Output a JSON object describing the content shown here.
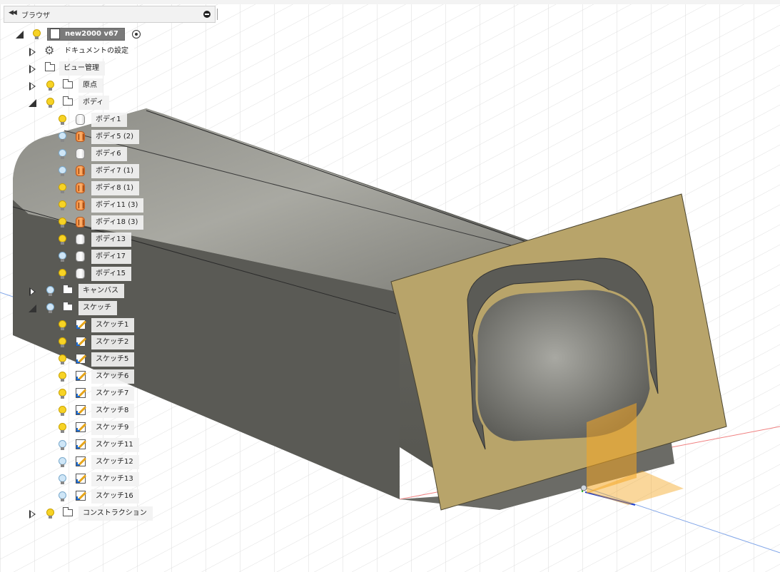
{
  "browser": {
    "title": "ブラウザ",
    "root": {
      "name": "new2000 v67"
    },
    "items": [
      {
        "label": "ドキュメントの設定",
        "icon": "gear-icon"
      },
      {
        "label": "ビュー管理",
        "icon": "folder-icon"
      },
      {
        "label": "原点",
        "icon": "folder-icon"
      },
      {
        "label": "ボディ",
        "icon": "folder-icon"
      }
    ],
    "bodies": [
      {
        "label": "ボディ1",
        "color": "gray"
      },
      {
        "label": "ボディ5 (2)",
        "color": "orange"
      },
      {
        "label": "ボディ6",
        "color": "gray"
      },
      {
        "label": "ボディ7 (1)",
        "color": "orange"
      },
      {
        "label": "ボディ8 (1)",
        "color": "orange"
      },
      {
        "label": "ボディ11 (3)",
        "color": "orange"
      },
      {
        "label": "ボディ18 (3)",
        "color": "orange"
      },
      {
        "label": "ボディ13",
        "color": "gray"
      },
      {
        "label": "ボディ17",
        "color": "gray"
      },
      {
        "label": "ボディ15",
        "color": "gray"
      }
    ],
    "canvas": {
      "label": "キャンバス"
    },
    "sketch_folder": {
      "label": "スケッチ"
    },
    "sketches": [
      {
        "label": "スケッチ1"
      },
      {
        "label": "スケッチ2"
      },
      {
        "label": "スケッチ5"
      },
      {
        "label": "スケッチ6"
      },
      {
        "label": "スケッチ7"
      },
      {
        "label": "スケッチ8"
      },
      {
        "label": "スケッチ9"
      },
      {
        "label": "スケッチ11"
      },
      {
        "label": "スケッチ12"
      },
      {
        "label": "スケッチ13"
      },
      {
        "label": "スケッチ16"
      }
    ],
    "construction": {
      "label": "コンストラクション"
    }
  },
  "colors": {
    "surface": "#b8a46a",
    "body_dark": "#5d5d58",
    "plane_orange": "#f4a622",
    "axis_red": "#e05050",
    "axis_green": "#2bbf2b",
    "axis_blue": "#2040d0"
  }
}
